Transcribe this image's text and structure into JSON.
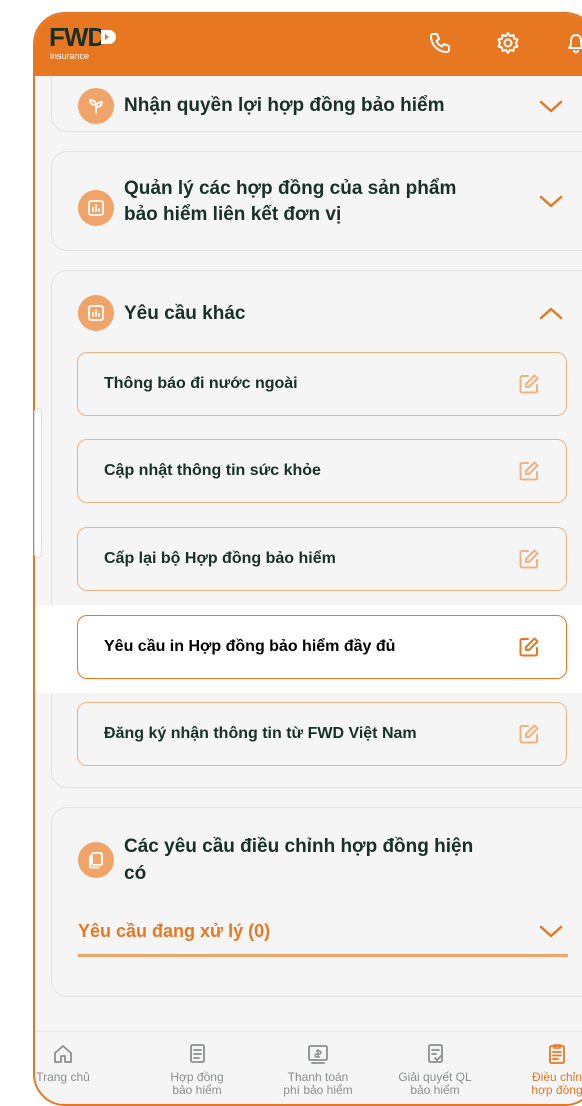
{
  "header": {
    "logo_text": "FWD",
    "logo_sub": "insurance",
    "icons": [
      "phone-icon",
      "gear-icon",
      "bell-icon"
    ]
  },
  "cards": {
    "benefits": {
      "title": "Nhận quyền lợi hợp đồng bảo hiểm"
    },
    "unit_linked": {
      "title_line1": "Quản lý các hợp đồng của sản phẩm",
      "title_line2": "bảo hiểm liên kết đơn vị"
    },
    "other": {
      "title": "Yêu cầu khác",
      "items": [
        {
          "label": "Thông báo đi nước ngoài"
        },
        {
          "label": "Cập nhật thông tin sức khỏe"
        },
        {
          "label": "Cấp lại bộ Hợp đồng bảo hiểm"
        },
        {
          "label": "Yêu cầu in Hợp đồng bảo hiểm đầy đủ"
        },
        {
          "label": "Đăng ký nhận thông tin từ FWD Việt Nam"
        }
      ]
    },
    "adjust": {
      "title_line1": "Các yêu cầu điều chỉnh hợp đồng hiện",
      "title_line2": "có",
      "pending_label": "Yêu cầu đang xử lý (0)"
    }
  },
  "nav": [
    {
      "line1": "Trang chủ",
      "line2": "",
      "icon": "home-icon"
    },
    {
      "line1": "Hợp đồng",
      "line2": "bảo hiểm",
      "icon": "document-icon"
    },
    {
      "line1": "Thanh toán",
      "line2": "phí bảo hiểm",
      "icon": "payment-icon"
    },
    {
      "line1": "Giải quyết QL",
      "line2": "bảo hiểm",
      "icon": "claim-icon"
    },
    {
      "line1": "Điều chỉn",
      "line2": "hợp đồng",
      "icon": "clipboard-icon"
    }
  ],
  "colors": {
    "brand_orange": "#e87722",
    "dark_green": "#183028",
    "light_orange": "#f0a46a"
  }
}
